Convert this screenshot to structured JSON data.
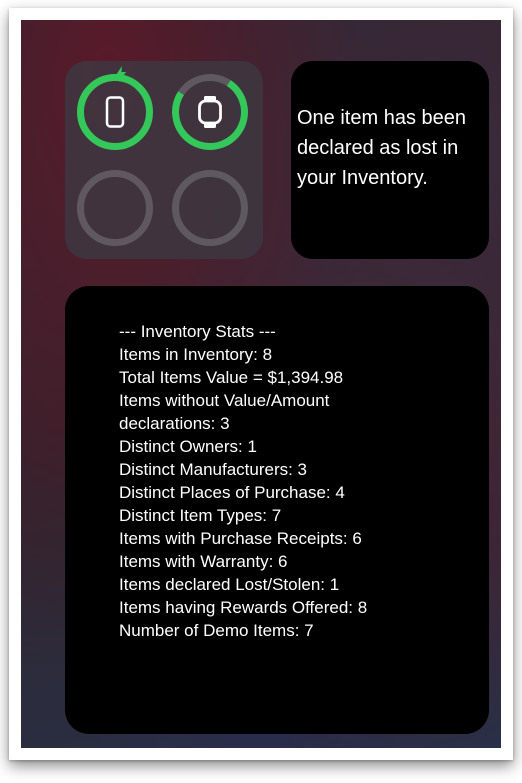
{
  "battery_widget": {
    "devices": [
      {
        "icon": "iphone-icon",
        "charging": true,
        "level": 1.0,
        "color": "#34c759"
      },
      {
        "icon": "apple-watch-icon",
        "charging": false,
        "level": 0.88,
        "color": "#34c759"
      },
      {
        "icon": "empty-slot",
        "charging": false,
        "level": 0.0
      },
      {
        "icon": "empty-slot",
        "charging": false,
        "level": 0.0
      }
    ]
  },
  "message_widget": {
    "text": "One item has been declared as lost in your Inventory."
  },
  "stats_widget": {
    "lines": [
      "--- Inventory Stats ---",
      "Items in Inventory: 8",
      "Total Items Value = $1,394.98",
      "Items without Value/Amount",
      "declarations: 3",
      "Distinct Owners: 1",
      "Distinct Manufacturers: 3",
      "Distinct Places of Purchase: 4",
      "Distinct Item Types: 7",
      "Items with Purchase Receipts: 6",
      "Items with Warranty: 6",
      "Items declared Lost/Stolen: 1",
      "Items having Rewards Offered: 8",
      "Number of Demo Items: 7"
    ]
  }
}
